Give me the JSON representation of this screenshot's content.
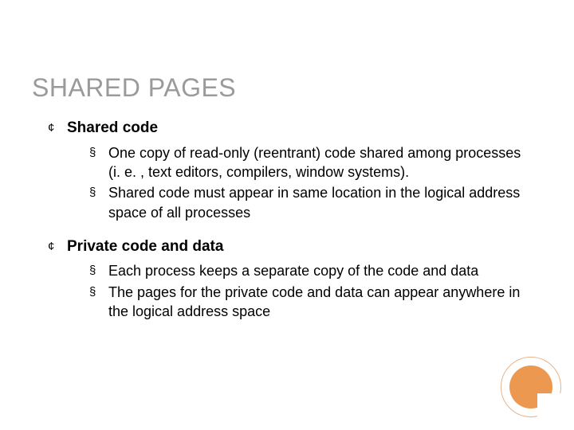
{
  "title": "SHARED PAGES",
  "sections": [
    {
      "heading": "Shared code",
      "items": [
        "One copy of read-only (reentrant) code shared among processes (i. e. , text editors, compilers, window systems).",
        "Shared code must appear in same location in the logical address space of all processes"
      ]
    },
    {
      "heading": "Private code and data",
      "items": [
        "Each process keeps a separate copy of the code and data",
        "The pages for the private code and data can appear anywhere in the logical address space"
      ]
    }
  ],
  "bullets": {
    "level1": "¢",
    "level2": "§"
  },
  "accent_color": "#ed9851"
}
